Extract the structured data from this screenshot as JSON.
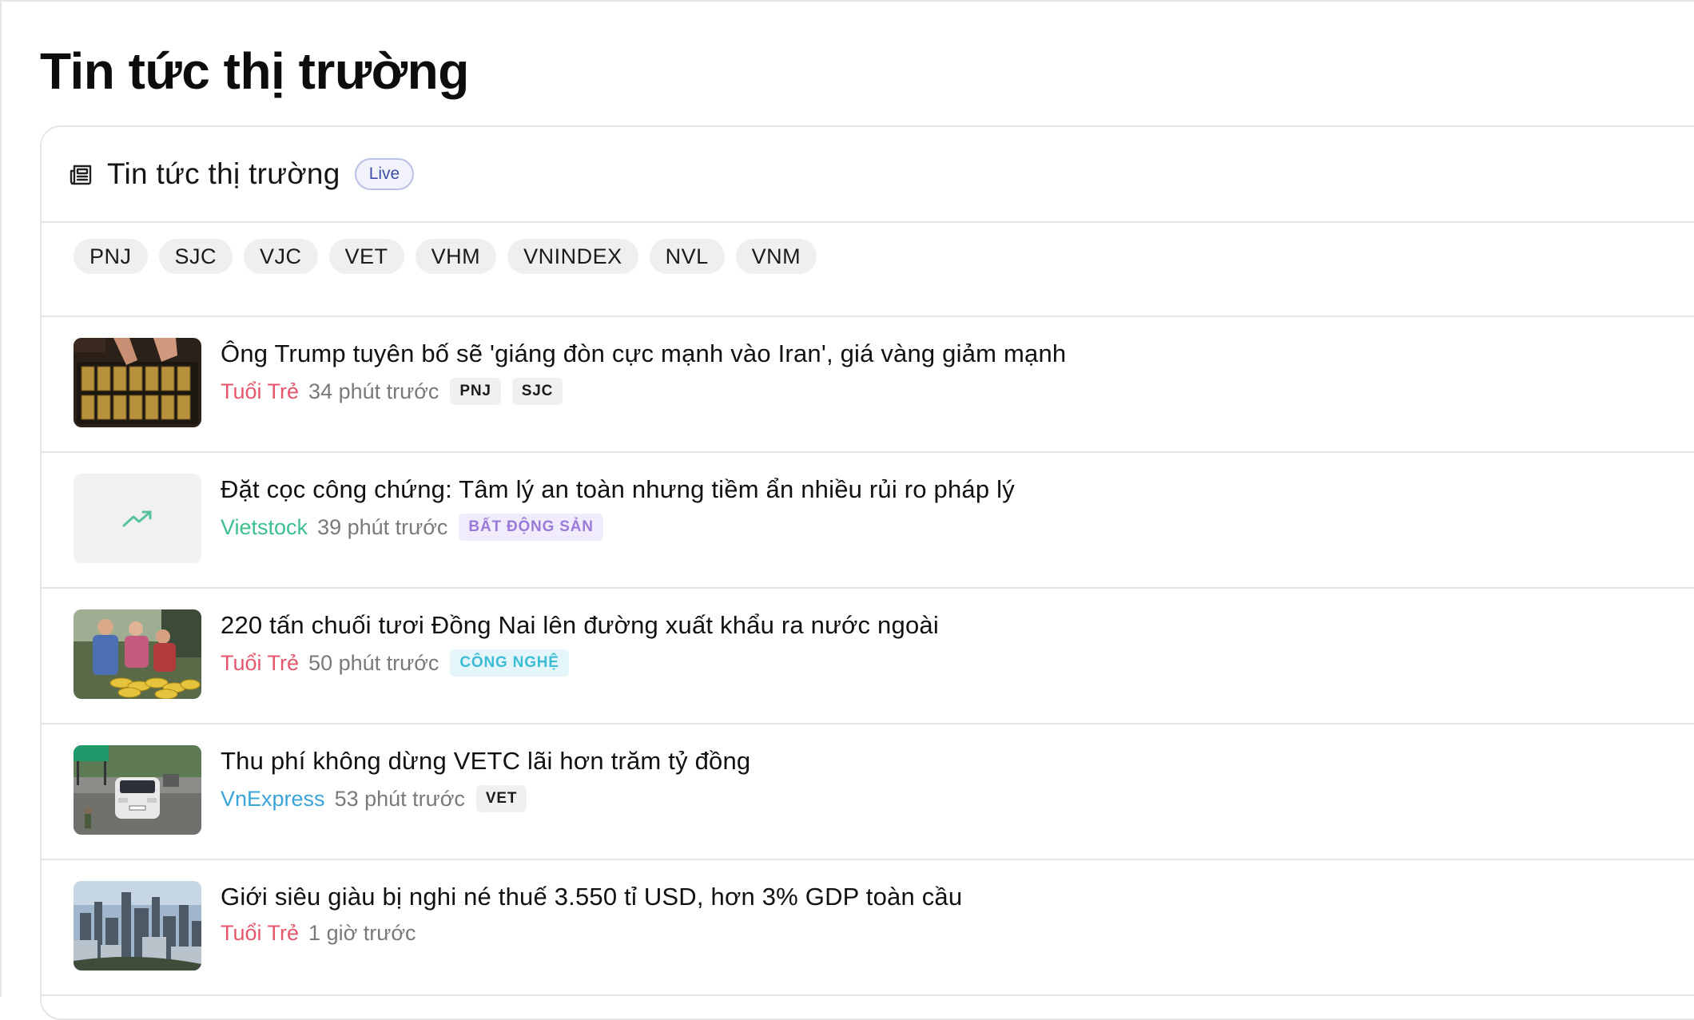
{
  "page": {
    "title": "Tin tức thị trường"
  },
  "panel": {
    "title": "Tin tức thị trường",
    "live_badge": "Live",
    "icon": "newspaper-icon"
  },
  "filters": [
    "PNJ",
    "SJC",
    "VJC",
    "VET",
    "VHM",
    "VNINDEX",
    "NVL",
    "VNM"
  ],
  "colors": {
    "tuoitre": "#e5566c",
    "vietstock": "#3fbf8e",
    "vnexpress": "#3aa4d9",
    "realestate_tag": "#9a7ad8",
    "tech_tag": "#3cbcd5"
  },
  "news": [
    {
      "title": "Ông Trump tuyên bố sẽ 'giáng đòn cực mạnh vào Iran', giá vàng giảm mạnh",
      "source": "Tuổi Trẻ",
      "time": "34 phút trước",
      "tags": [
        "PNJ",
        "SJC"
      ],
      "thumbnail": "gold-bars-image"
    },
    {
      "title": "Đặt cọc công chứng: Tâm lý an toàn nhưng tiềm ẩn nhiều rủi ro pháp lý",
      "source": "Vietstock",
      "time": "39 phút trước",
      "tags": [
        "BẤT ĐỘNG SẢN"
      ],
      "thumbnail": "trending-up-icon"
    },
    {
      "title": "220 tấn chuối tươi Đồng Nai lên đường xuất khẩu ra nước ngoài",
      "source": "Tuổi Trẻ",
      "time": "50 phút trước",
      "tags": [
        "CÔNG NGHỆ"
      ],
      "thumbnail": "banana-market-image"
    },
    {
      "title": "Thu phí không dừng VETC lãi hơn trăm tỷ đồng",
      "source": "VnExpress",
      "time": "53 phút trước",
      "tags": [
        "VET"
      ],
      "thumbnail": "toll-station-car-image"
    },
    {
      "title": "Giới siêu giàu bị nghi né thuế 3.550 tỉ USD, hơn 3% GDP toàn cầu",
      "source": "Tuổi Trẻ",
      "time": "1 giờ trước",
      "tags": [],
      "thumbnail": "city-skyline-image"
    }
  ]
}
